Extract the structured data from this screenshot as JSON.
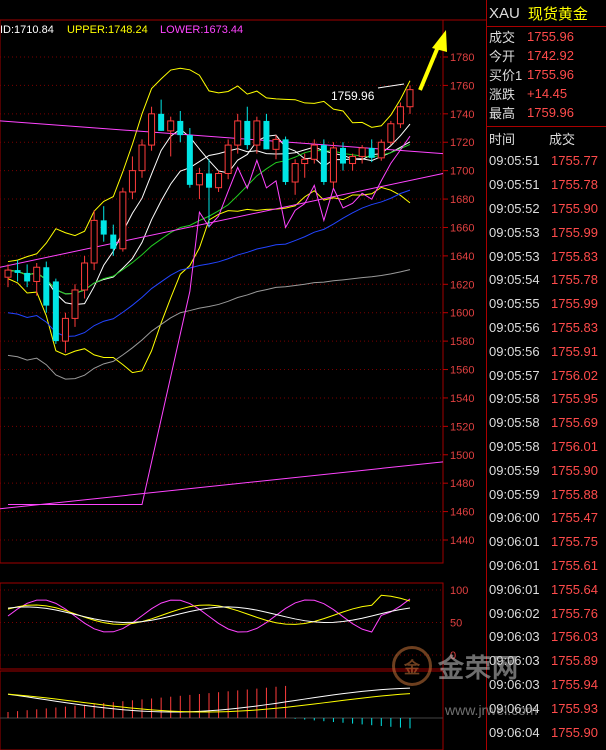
{
  "chart_data": {
    "type": "candlestick",
    "bollinger_label": {
      "mid": "ID:1710.84",
      "upper": "UPPER:1748.24",
      "lower": "LOWER:1673.44"
    },
    "y_axis_ticks": [
      1780,
      1760,
      1740,
      1720,
      1700,
      1680,
      1660,
      1640,
      1620,
      1600,
      1580,
      1560,
      1540,
      1520,
      1500,
      1480,
      1460,
      1440
    ],
    "ylim": [
      1430,
      1795
    ],
    "high_annotation": "1759.96",
    "candles": [
      {
        "o": 1625,
        "h": 1634,
        "l": 1618,
        "c": 1630
      },
      {
        "o": 1630,
        "h": 1637,
        "l": 1622,
        "c": 1628
      },
      {
        "o": 1628,
        "h": 1634,
        "l": 1618,
        "c": 1622
      },
      {
        "o": 1622,
        "h": 1635,
        "l": 1612,
        "c": 1632
      },
      {
        "o": 1632,
        "h": 1636,
        "l": 1600,
        "c": 1605
      },
      {
        "o": 1622,
        "h": 1624,
        "l": 1578,
        "c": 1580
      },
      {
        "o": 1580,
        "h": 1600,
        "l": 1572,
        "c": 1596
      },
      {
        "o": 1596,
        "h": 1620,
        "l": 1590,
        "c": 1616
      },
      {
        "o": 1616,
        "h": 1640,
        "l": 1610,
        "c": 1635
      },
      {
        "o": 1635,
        "h": 1672,
        "l": 1630,
        "c": 1665
      },
      {
        "o": 1665,
        "h": 1675,
        "l": 1650,
        "c": 1655
      },
      {
        "o": 1655,
        "h": 1662,
        "l": 1640,
        "c": 1645
      },
      {
        "o": 1645,
        "h": 1688,
        "l": 1643,
        "c": 1685
      },
      {
        "o": 1685,
        "h": 1710,
        "l": 1680,
        "c": 1700
      },
      {
        "o": 1700,
        "h": 1722,
        "l": 1695,
        "c": 1718
      },
      {
        "o": 1718,
        "h": 1745,
        "l": 1714,
        "c": 1740
      },
      {
        "o": 1740,
        "h": 1750,
        "l": 1728,
        "c": 1728
      },
      {
        "o": 1728,
        "h": 1738,
        "l": 1710,
        "c": 1735
      },
      {
        "o": 1735,
        "h": 1742,
        "l": 1720,
        "c": 1725
      },
      {
        "o": 1725,
        "h": 1730,
        "l": 1688,
        "c": 1690
      },
      {
        "o": 1690,
        "h": 1702,
        "l": 1680,
        "c": 1698
      },
      {
        "o": 1698,
        "h": 1708,
        "l": 1660,
        "c": 1688
      },
      {
        "o": 1688,
        "h": 1700,
        "l": 1685,
        "c": 1698
      },
      {
        "o": 1698,
        "h": 1722,
        "l": 1694,
        "c": 1718
      },
      {
        "o": 1718,
        "h": 1740,
        "l": 1712,
        "c": 1735
      },
      {
        "o": 1735,
        "h": 1745,
        "l": 1715,
        "c": 1718
      },
      {
        "o": 1718,
        "h": 1738,
        "l": 1712,
        "c": 1735
      },
      {
        "o": 1735,
        "h": 1740,
        "l": 1715,
        "c": 1715
      },
      {
        "o": 1715,
        "h": 1725,
        "l": 1708,
        "c": 1722
      },
      {
        "o": 1722,
        "h": 1724,
        "l": 1690,
        "c": 1692
      },
      {
        "o": 1692,
        "h": 1708,
        "l": 1683,
        "c": 1705
      },
      {
        "o": 1705,
        "h": 1712,
        "l": 1695,
        "c": 1708
      },
      {
        "o": 1708,
        "h": 1722,
        "l": 1705,
        "c": 1718
      },
      {
        "o": 1718,
        "h": 1722,
        "l": 1690,
        "c": 1692
      },
      {
        "o": 1692,
        "h": 1720,
        "l": 1688,
        "c": 1716
      },
      {
        "o": 1716,
        "h": 1720,
        "l": 1700,
        "c": 1705
      },
      {
        "o": 1705,
        "h": 1712,
        "l": 1700,
        "c": 1710
      },
      {
        "o": 1710,
        "h": 1718,
        "l": 1705,
        "c": 1716
      },
      {
        "o": 1716,
        "h": 1722,
        "l": 1706,
        "c": 1709
      },
      {
        "o": 1709,
        "h": 1722,
        "l": 1707,
        "c": 1720
      },
      {
        "o": 1720,
        "h": 1735,
        "l": 1718,
        "c": 1733
      },
      {
        "o": 1733,
        "h": 1748,
        "l": 1730,
        "c": 1745
      },
      {
        "o": 1745,
        "h": 1760,
        "l": 1740,
        "c": 1757
      }
    ],
    "oscillator_ticks": [
      100,
      50,
      0
    ],
    "colors": {
      "up": "#ff3c3c",
      "down": "#00e5e5",
      "upper": "#ffff00",
      "mid": "#ffffff",
      "lower": "#ff44ff",
      "axis": "#c00000",
      "ma_green": "#22cc22",
      "ma_blue": "#2244ff",
      "ma_gray": "#9a9a9a"
    }
  },
  "side": {
    "symbol": "XAU",
    "name": "现货黄金",
    "quotes": [
      {
        "label": "成交",
        "value": "1755.96"
      },
      {
        "label": "今开",
        "value": "1742.92"
      },
      {
        "label": "买价1",
        "value": "1755.96"
      },
      {
        "label": "涨跌",
        "value": "+14.45"
      },
      {
        "label": "最高",
        "value": "1759.96"
      }
    ],
    "table_header": {
      "time": "时间",
      "price": "成交"
    },
    "ticks": [
      {
        "t": "09:05:51",
        "p": "1755.77"
      },
      {
        "t": "09:05:51",
        "p": "1755.78"
      },
      {
        "t": "09:05:52",
        "p": "1755.90"
      },
      {
        "t": "09:05:53",
        "p": "1755.99"
      },
      {
        "t": "09:05:53",
        "p": "1755.83"
      },
      {
        "t": "09:05:54",
        "p": "1755.78"
      },
      {
        "t": "09:05:55",
        "p": "1755.99"
      },
      {
        "t": "09:05:56",
        "p": "1755.83"
      },
      {
        "t": "09:05:56",
        "p": "1755.91"
      },
      {
        "t": "09:05:57",
        "p": "1756.02"
      },
      {
        "t": "09:05:58",
        "p": "1755.95"
      },
      {
        "t": "09:05:58",
        "p": "1755.69"
      },
      {
        "t": "09:05:58",
        "p": "1756.01"
      },
      {
        "t": "09:05:59",
        "p": "1755.90"
      },
      {
        "t": "09:05:59",
        "p": "1755.88"
      },
      {
        "t": "09:06:00",
        "p": "1755.47"
      },
      {
        "t": "09:06:01",
        "p": "1755.75"
      },
      {
        "t": "09:06:01",
        "p": "1755.61"
      },
      {
        "t": "09:06:01",
        "p": "1755.64"
      },
      {
        "t": "09:06:02",
        "p": "1755.76"
      },
      {
        "t": "09:06:03",
        "p": "1756.03"
      },
      {
        "t": "09:06:03",
        "p": "1755.89"
      },
      {
        "t": "09:06:03",
        "p": "1755.94"
      },
      {
        "t": "09:06:04",
        "p": "1755.93"
      },
      {
        "t": "09:06:04",
        "p": "1755.90"
      }
    ]
  },
  "watermark": {
    "logo_text": "金",
    "brand": "金荣网",
    "url": "www.jrwei.com"
  }
}
